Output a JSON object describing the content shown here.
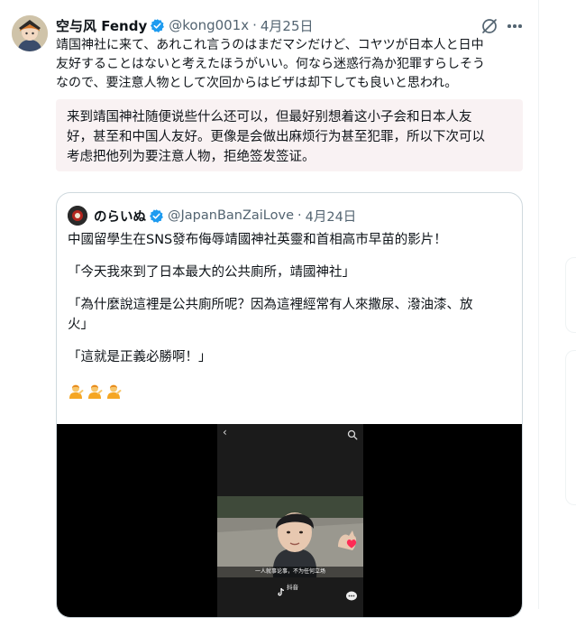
{
  "tweet": {
    "display_name": "空与风 Fendy",
    "handle": "@kong001x",
    "separator": "·",
    "date": "4月25日",
    "text_lines": [
      "靖国神社に来て、あれこれ言うのはまだマシだけど、コヤツが日本人と日中",
      "友好することはないと考えたほうがいい。何なら迷惑行為か犯罪すらしそう",
      "なので、要注意人物として次回からはビザは却下しても良いと思われ。"
    ],
    "translation_lines": [
      "来到靖国神社随便说些什么还可以，但最好别想着这小子会和日本人友",
      "好，甚至和中国人友好。更像是会做出麻烦行为甚至犯罪，所以下次可以",
      "考虑把他列为要注意人物，拒绝签发签证。"
    ]
  },
  "quote": {
    "display_name": "のらいぬ",
    "handle": "@JapanBanZaiLove",
    "separator": "·",
    "date": "4月24日",
    "paragraphs": [
      "中國留學生在SNS發布侮辱靖國神社英靈和首相高市早苗的影片！",
      "「今天我來到了日本最大的公共廁所，靖國神社」",
      "「為什麼說這裡是公共廁所呢？因為這裡經常有人來撒尿、潑油漆、放",
      "火」",
      "「這就是正義必勝啊！」"
    ],
    "emoji": [
      "person-tipping-hand",
      "person-tipping-hand",
      "person-tipping-hand"
    ]
  },
  "video": {
    "caption": "一人就事论事，不为任何立场",
    "watermark": "抖音"
  },
  "colors": {
    "verified": "#1d9bf0",
    "text": "#0f1419",
    "secondary": "#536471",
    "translation_bg": "#f9f2f3",
    "border": "#cfd9de"
  },
  "icons": [
    "grok-icon",
    "more-icon",
    "verified-badge-icon",
    "back-arrow-icon",
    "search-icon",
    "like-icon",
    "comment-icon"
  ]
}
